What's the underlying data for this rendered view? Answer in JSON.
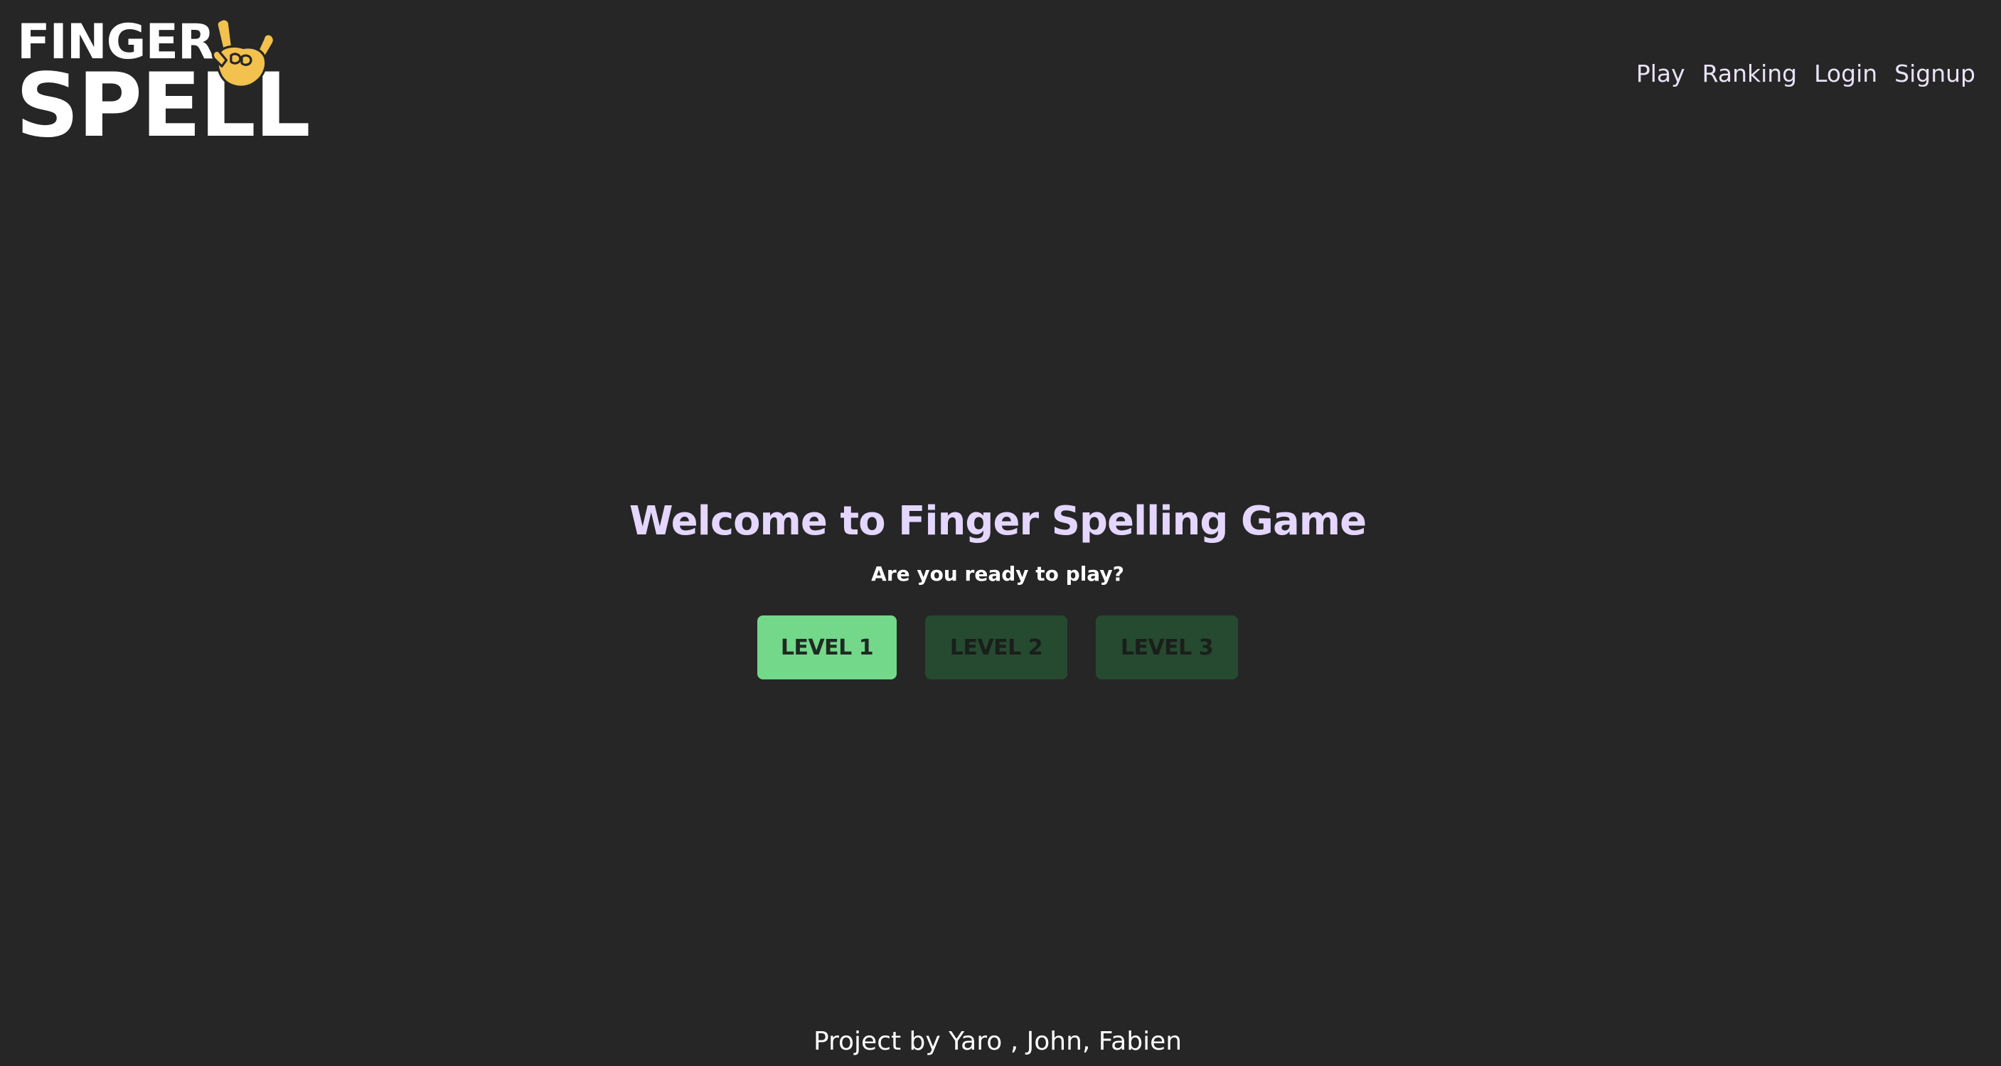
{
  "logo": {
    "line1": "FINGER",
    "line2": "SPELL",
    "icon": "hand-sign-icon",
    "icon_color": "#f2c14e"
  },
  "nav": {
    "items": [
      {
        "label": "Play"
      },
      {
        "label": "Ranking"
      },
      {
        "label": "Login"
      },
      {
        "label": "Signup"
      }
    ]
  },
  "hero": {
    "title": "Welcome to Finger Spelling Game",
    "subtitle": "Are you ready to play?"
  },
  "levels": [
    {
      "label": "LEVEL 1",
      "state": "available"
    },
    {
      "label": "LEVEL 2",
      "state": "locked"
    },
    {
      "label": "LEVEL 3",
      "state": "locked"
    }
  ],
  "footer": {
    "text": "Project by Yaro , John, Fabien"
  },
  "colors": {
    "background": "#262626",
    "title": "#e4d6ff",
    "level_active": "#73d88a",
    "level_locked": "#254a30"
  }
}
